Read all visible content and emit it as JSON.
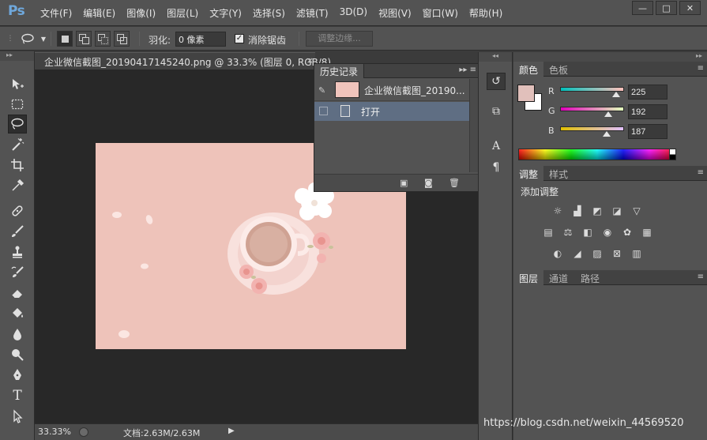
{
  "app": {
    "logo": "Ps",
    "menu": [
      "文件(F)",
      "编辑(E)",
      "图像(I)",
      "图层(L)",
      "文字(Y)",
      "选择(S)",
      "滤镜(T)",
      "3D(D)",
      "视图(V)",
      "窗口(W)",
      "帮助(H)"
    ],
    "window_buttons": [
      "—",
      "□",
      "✕"
    ]
  },
  "options": {
    "feather_label": "羽化:",
    "feather_value": "0 像素",
    "antialias_label": "消除锯齿",
    "antialias_checked": true,
    "refine_edge_label": "调整边缘..."
  },
  "tools": [
    "move-icon",
    "marquee-icon",
    "lasso-icon",
    "magic-wand-icon",
    "crop-icon",
    "eyedropper-icon",
    "healing-brush-icon",
    "brush-icon",
    "stamp-icon",
    "history-brush-icon",
    "eraser-icon",
    "paint-bucket-icon",
    "blur-icon",
    "dodge-icon",
    "pen-icon",
    "type-icon",
    "path-select-icon"
  ],
  "document": {
    "tab_title": "企业微信截图_20190417145240.png @ 33.3% (图层 0, RGB/8)",
    "tab_close": "×",
    "zoom": "33.33%",
    "doc_info": "文档:2.63M/2.63M"
  },
  "history": {
    "title": "历史记录",
    "snapshot_label": "企业微信截图_20190...",
    "step_label": "打开"
  },
  "color_panel": {
    "tabs": [
      "颜色",
      "色板"
    ],
    "r_label": "R",
    "g_label": "G",
    "b_label": "B",
    "r": "225",
    "g": "192",
    "b": "187",
    "foreground_color": "#e1c0bb",
    "background_color": "#ffffff",
    "slider_fraction": {
      "r": 0.88,
      "g": 0.75,
      "b": 0.73
    }
  },
  "adjustments": {
    "tabs": [
      "调整",
      "样式"
    ],
    "title": "添加调整"
  },
  "layers": {
    "tabs": [
      "图层",
      "通道",
      "路径"
    ]
  },
  "watermark": "https://blog.csdn.net/weixin_44569520"
}
